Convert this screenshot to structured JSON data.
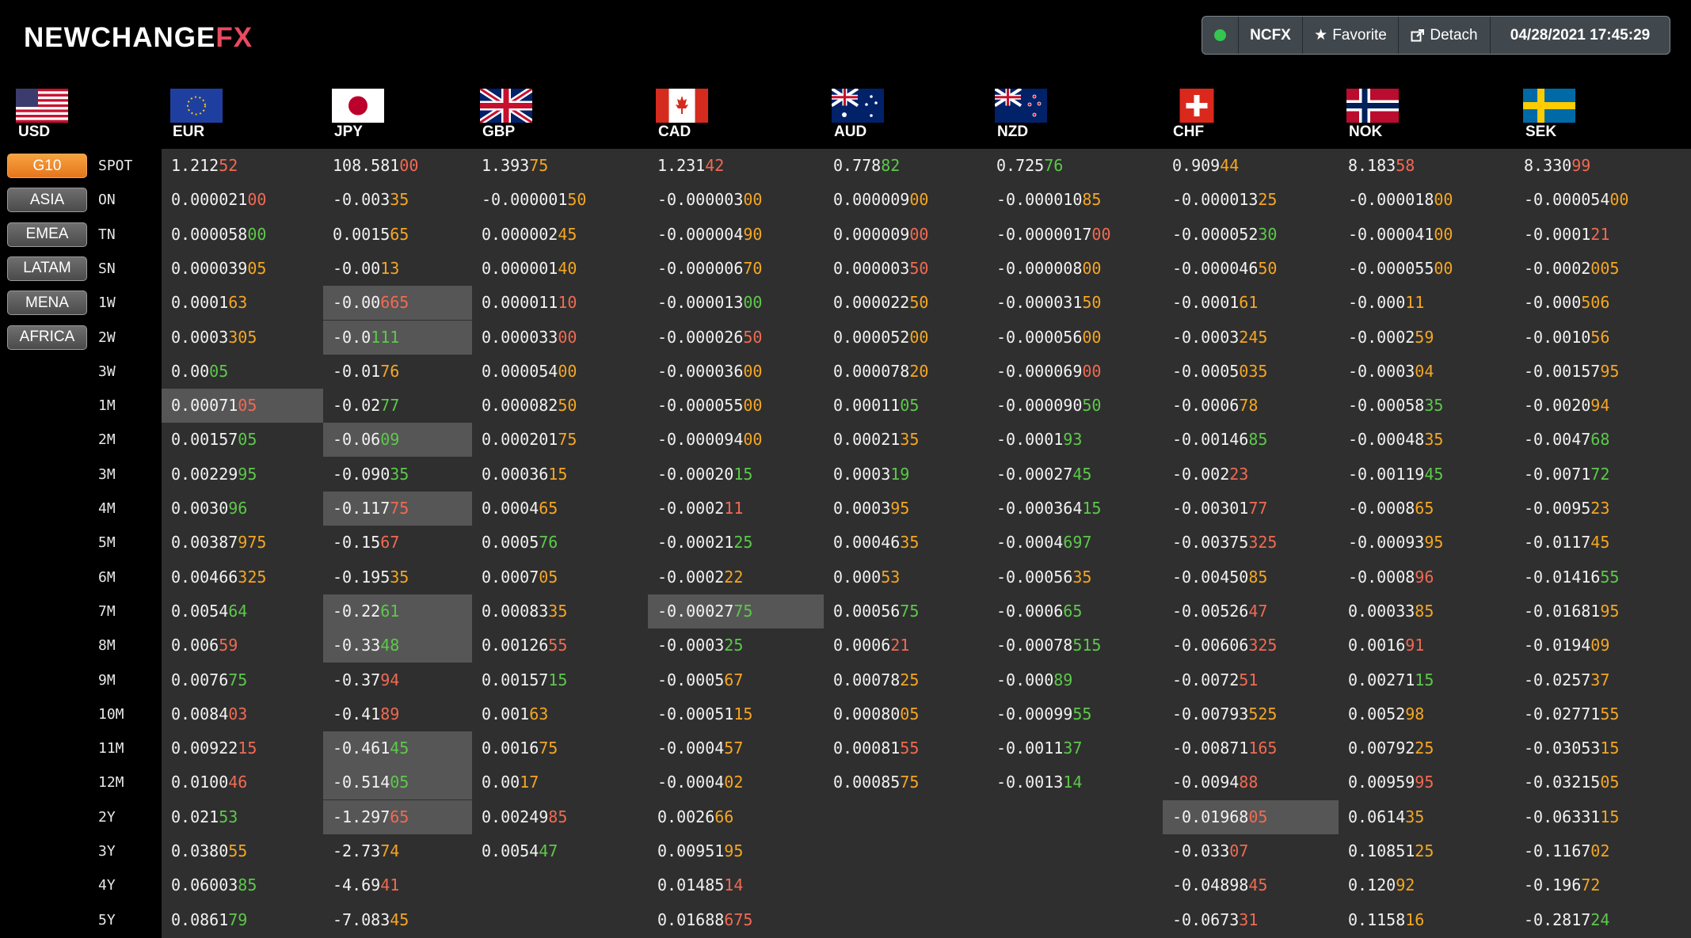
{
  "brand": {
    "part1": "NEWCHANGE",
    "part2": "FX"
  },
  "topbar": {
    "status": "online",
    "source": "NCFX",
    "favorite": "Favorite",
    "detach": "Detach",
    "datetime": "04/28/2021 17:45:29"
  },
  "currencies": [
    "USD",
    "EUR",
    "JPY",
    "GBP",
    "CAD",
    "AUD",
    "NZD",
    "CHF",
    "NOK",
    "SEK"
  ],
  "regions": [
    {
      "label": "G10",
      "active": true
    },
    {
      "label": "ASIA",
      "active": false
    },
    {
      "label": "EMEA",
      "active": false
    },
    {
      "label": "LATAM",
      "active": false
    },
    {
      "label": "MENA",
      "active": false
    },
    {
      "label": "AFRICA",
      "active": false
    }
  ],
  "tenors": [
    "SPOT",
    "ON",
    "TN",
    "SN",
    "1W",
    "2W",
    "3W",
    "1M",
    "2M",
    "3M",
    "4M",
    "5M",
    "6M",
    "7M",
    "8M",
    "9M",
    "10M",
    "11M",
    "12M",
    "2Y",
    "3Y",
    "4Y",
    "5Y"
  ],
  "grid": [
    [
      [
        "1.212",
        "52",
        "d"
      ],
      [
        "108.581",
        "00",
        "d"
      ],
      [
        "1.393",
        "75",
        "o"
      ],
      [
        "1.231",
        "42",
        "d"
      ],
      [
        "0.778",
        "82",
        "u"
      ],
      [
        "0.725",
        "76",
        "u"
      ],
      [
        "0.909",
        "44",
        "o"
      ],
      [
        "8.183",
        "58",
        "d"
      ],
      [
        "8.330",
        "99",
        "d"
      ]
    ],
    [
      [
        "0.000021",
        "00",
        "d"
      ],
      [
        "-0.003",
        "35",
        "o"
      ],
      [
        "-0.000001",
        "50",
        "o"
      ],
      [
        "-0.000003",
        "00",
        "o"
      ],
      [
        "0.000009",
        "00",
        "o"
      ],
      [
        "-0.000010",
        "85",
        "o"
      ],
      [
        "-0.000013",
        "25",
        "o"
      ],
      [
        "-0.000018",
        "00",
        "o"
      ],
      [
        "-0.000054",
        "00",
        "o"
      ]
    ],
    [
      [
        "0.000058",
        "00",
        "u"
      ],
      [
        "0.0015",
        "65",
        "o"
      ],
      [
        "0.000002",
        "45",
        "o"
      ],
      [
        "-0.000004",
        "90",
        "o"
      ],
      [
        "0.000009",
        "00",
        "d"
      ],
      [
        "-0.0000017",
        "00",
        "d"
      ],
      [
        "-0.000052",
        "30",
        "u"
      ],
      [
        "-0.000041",
        "00",
        "o"
      ],
      [
        "-0.0001",
        "21",
        "d"
      ]
    ],
    [
      [
        "0.000039",
        "05",
        "o"
      ],
      [
        "-0.00",
        "13",
        "o"
      ],
      [
        "0.000001",
        "40",
        "o"
      ],
      [
        "-0.000006",
        "70",
        "o"
      ],
      [
        "0.000003",
        "50",
        "d"
      ],
      [
        "-0.000008",
        "00",
        "o"
      ],
      [
        "-0.000046",
        "50",
        "o"
      ],
      [
        "-0.000055",
        "00",
        "o"
      ],
      [
        "-0.0002",
        "005",
        "o"
      ]
    ],
    [
      [
        "0.0001",
        "63",
        "o"
      ],
      [
        "-0.00",
        "665",
        "d"
      ],
      [
        "0.000011",
        "10",
        "d"
      ],
      [
        "-0.000013",
        "00",
        "u"
      ],
      [
        "0.000022",
        "50",
        "o"
      ],
      [
        "-0.000031",
        "50",
        "o"
      ],
      [
        "-0.0001",
        "61",
        "o"
      ],
      [
        "-0.000",
        "11",
        "o"
      ],
      [
        "-0.000",
        "506",
        "o"
      ]
    ],
    [
      [
        "0.0003",
        "305",
        "o"
      ],
      [
        "-0.0",
        "111",
        "u"
      ],
      [
        "0.000033",
        "00",
        "d"
      ],
      [
        "-0.000026",
        "50",
        "d"
      ],
      [
        "0.000052",
        "00",
        "o"
      ],
      [
        "-0.000056",
        "00",
        "o"
      ],
      [
        "-0.0003",
        "245",
        "o"
      ],
      [
        "-0.0002",
        "59",
        "o"
      ],
      [
        "-0.0010",
        "56",
        "o"
      ]
    ],
    [
      [
        "0.00",
        "05",
        "u"
      ],
      [
        "-0.01",
        "76",
        "o"
      ],
      [
        "0.000054",
        "00",
        "o"
      ],
      [
        "-0.000036",
        "00",
        "o"
      ],
      [
        "0.000078",
        "20",
        "o"
      ],
      [
        "-0.000069",
        "00",
        "d"
      ],
      [
        "-0.0005",
        "035",
        "o"
      ],
      [
        "-0.0003",
        "04",
        "o"
      ],
      [
        "-0.00157",
        "95",
        "o"
      ]
    ],
    [
      [
        "0.00071",
        "05",
        "d"
      ],
      [
        "-0.02",
        "77",
        "u"
      ],
      [
        "0.000082",
        "50",
        "o"
      ],
      [
        "-0.000055",
        "00",
        "o"
      ],
      [
        "0.00011",
        "05",
        "u"
      ],
      [
        "-0.000090",
        "50",
        "u"
      ],
      [
        "-0.0006",
        "78",
        "o"
      ],
      [
        "-0.00058",
        "35",
        "u"
      ],
      [
        "-0.0020",
        "94",
        "o"
      ]
    ],
    [
      [
        "0.00157",
        "05",
        "u"
      ],
      [
        "-0.06",
        "09",
        "u"
      ],
      [
        "0.000201",
        "75",
        "o"
      ],
      [
        "-0.000094",
        "00",
        "o"
      ],
      [
        "0.00021",
        "35",
        "o"
      ],
      [
        "-0.0001",
        "93",
        "u"
      ],
      [
        "-0.00146",
        "85",
        "u"
      ],
      [
        "-0.00048",
        "35",
        "o"
      ],
      [
        "-0.0047",
        "68",
        "u"
      ]
    ],
    [
      [
        "0.00229",
        "95",
        "u"
      ],
      [
        "-0.090",
        "35",
        "u"
      ],
      [
        "0.00036",
        "15",
        "o"
      ],
      [
        "-0.00020",
        "15",
        "u"
      ],
      [
        "0.0003",
        "19",
        "u"
      ],
      [
        "-0.00027",
        "45",
        "u"
      ],
      [
        "-0.002",
        "23",
        "d"
      ],
      [
        "-0.00119",
        "45",
        "u"
      ],
      [
        "-0.0071",
        "72",
        "u"
      ]
    ],
    [
      [
        "0.0030",
        "96",
        "u"
      ],
      [
        "-0.117",
        "75",
        "d"
      ],
      [
        "0.0004",
        "65",
        "o"
      ],
      [
        "-0.0002",
        "11",
        "d"
      ],
      [
        "0.0003",
        "95",
        "o"
      ],
      [
        "-0.000364",
        "15",
        "u"
      ],
      [
        "-0.00301",
        "77",
        "d"
      ],
      [
        "-0.0008",
        "65",
        "o"
      ],
      [
        "-0.0095",
        "23",
        "o"
      ]
    ],
    [
      [
        "0.00387",
        "975",
        "o"
      ],
      [
        "-0.15",
        "67",
        "d"
      ],
      [
        "0.0005",
        "76",
        "u"
      ],
      [
        "-0.00021",
        "25",
        "u"
      ],
      [
        "0.00046",
        "35",
        "o"
      ],
      [
        "-0.0004",
        "697",
        "u"
      ],
      [
        "-0.00375",
        "325",
        "d"
      ],
      [
        "-0.00093",
        "95",
        "o"
      ],
      [
        "-0.0117",
        "45",
        "o"
      ]
    ],
    [
      [
        "0.00466",
        "325",
        "o"
      ],
      [
        "-0.195",
        "35",
        "o"
      ],
      [
        "0.0007",
        "05",
        "o"
      ],
      [
        "-0.0002",
        "22",
        "o"
      ],
      [
        "0.000",
        "53",
        "o"
      ],
      [
        "-0.00056",
        "35",
        "o"
      ],
      [
        "-0.00450",
        "85",
        "o"
      ],
      [
        "-0.0008",
        "96",
        "d"
      ],
      [
        "-0.01416",
        "55",
        "u"
      ]
    ],
    [
      [
        "0.0054",
        "64",
        "u"
      ],
      [
        "-0.22",
        "61",
        "u"
      ],
      [
        "0.00083",
        "35",
        "o"
      ],
      [
        "-0.00027",
        "75",
        "u"
      ],
      [
        "0.00056",
        "75",
        "u"
      ],
      [
        "-0.0006",
        "65",
        "u"
      ],
      [
        "-0.00526",
        "47",
        "d"
      ],
      [
        "0.00033",
        "85",
        "o"
      ],
      [
        "-0.01681",
        "95",
        "o"
      ]
    ],
    [
      [
        "0.006",
        "59",
        "d"
      ],
      [
        "-0.33",
        "48",
        "u"
      ],
      [
        "0.00126",
        "55",
        "d"
      ],
      [
        "-0.0003",
        "25",
        "u"
      ],
      [
        "0.0006",
        "21",
        "d"
      ],
      [
        "-0.00078",
        "515",
        "u"
      ],
      [
        "-0.00606",
        "325",
        "d"
      ],
      [
        "0.0016",
        "91",
        "d"
      ],
      [
        "-0.0194",
        "09",
        "o"
      ]
    ],
    [
      [
        "0.0076",
        "75",
        "u"
      ],
      [
        "-0.37",
        "94",
        "d"
      ],
      [
        "0.00157",
        "15",
        "u"
      ],
      [
        "-0.0005",
        "67",
        "o"
      ],
      [
        "0.00078",
        "25",
        "o"
      ],
      [
        "-0.000",
        "89",
        "u"
      ],
      [
        "-0.0072",
        "51",
        "d"
      ],
      [
        "0.00271",
        "15",
        "u"
      ],
      [
        "-0.0257",
        "37",
        "o"
      ]
    ],
    [
      [
        "0.0084",
        "03",
        "d"
      ],
      [
        "-0.41",
        "89",
        "d"
      ],
      [
        "0.001",
        "63",
        "o"
      ],
      [
        "-0.00051",
        "15",
        "o"
      ],
      [
        "0.00080",
        "05",
        "o"
      ],
      [
        "-0.00099",
        "55",
        "u"
      ],
      [
        "-0.00793",
        "525",
        "o"
      ],
      [
        "0.0052",
        "98",
        "o"
      ],
      [
        "-0.02771",
        "55",
        "o"
      ]
    ],
    [
      [
        "0.00922",
        "15",
        "d"
      ],
      [
        "-0.461",
        "45",
        "u"
      ],
      [
        "0.0016",
        "75",
        "o"
      ],
      [
        "-0.0004",
        "57",
        "o"
      ],
      [
        "0.00081",
        "55",
        "d"
      ],
      [
        "-0.0011",
        "37",
        "u"
      ],
      [
        "-0.00871",
        "165",
        "d"
      ],
      [
        "0.00792",
        "25",
        "o"
      ],
      [
        "-0.03053",
        "15",
        "o"
      ]
    ],
    [
      [
        "0.0100",
        "46",
        "d"
      ],
      [
        "-0.514",
        "05",
        "u"
      ],
      [
        "0.00",
        "17",
        "o"
      ],
      [
        "-0.0004",
        "02",
        "o"
      ],
      [
        "0.00085",
        "75",
        "o"
      ],
      [
        "-0.0013",
        "14",
        "u"
      ],
      [
        "-0.0094",
        "88",
        "d"
      ],
      [
        "0.00959",
        "95",
        "d"
      ],
      [
        "-0.03215",
        "05",
        "o"
      ]
    ],
    [
      [
        "0.021",
        "53",
        "u"
      ],
      [
        "-1.297",
        "65",
        "d"
      ],
      [
        "0.00249",
        "85",
        "d"
      ],
      [
        "0.0026",
        "66",
        "o"
      ],
      null,
      null,
      [
        "-0.01968",
        "05",
        "d"
      ],
      [
        "0.0614",
        "35",
        "o"
      ],
      [
        "-0.06331",
        "15",
        "o"
      ]
    ],
    [
      [
        "0.0380",
        "55",
        "o"
      ],
      [
        "-2.73",
        "74",
        "o"
      ],
      [
        "0.0054",
        "47",
        "u"
      ],
      [
        "0.00951",
        "95",
        "o"
      ],
      null,
      null,
      [
        "-0.033",
        "07",
        "d"
      ],
      [
        "0.10851",
        "25",
        "o"
      ],
      [
        "-0.1167",
        "02",
        "o"
      ]
    ],
    [
      [
        "0.06003",
        "85",
        "u"
      ],
      [
        "-4.69",
        "41",
        "d"
      ],
      null,
      [
        "0.01485",
        "14",
        "d"
      ],
      null,
      null,
      [
        "-0.04898",
        "45",
        "d"
      ],
      [
        "0.120",
        "92",
        "o"
      ],
      [
        "-0.196",
        "72",
        "o"
      ]
    ],
    [
      [
        "0.0861",
        "79",
        "u"
      ],
      [
        "-7.083",
        "45",
        "o"
      ],
      null,
      [
        "0.01688",
        "675",
        "d"
      ],
      null,
      null,
      [
        "-0.0673",
        "31",
        "d"
      ],
      [
        "0.1158",
        "16",
        "o"
      ],
      [
        "-0.2817",
        "24",
        "u"
      ]
    ]
  ],
  "highlights": {
    "JPY": [
      "1W",
      "2W",
      "2M",
      "4M",
      "7M",
      "8M",
      "11M",
      "12M",
      "2Y"
    ],
    "EUR": [
      "1M"
    ],
    "CAD": [
      "7M"
    ],
    "CHF": [
      "2Y"
    ]
  },
  "colors": {
    "up": "#5cc94a",
    "down": "#f06a52",
    "orange": "#f5a623",
    "accent": "#e5751c",
    "logo_fx": "#e84a5f"
  }
}
